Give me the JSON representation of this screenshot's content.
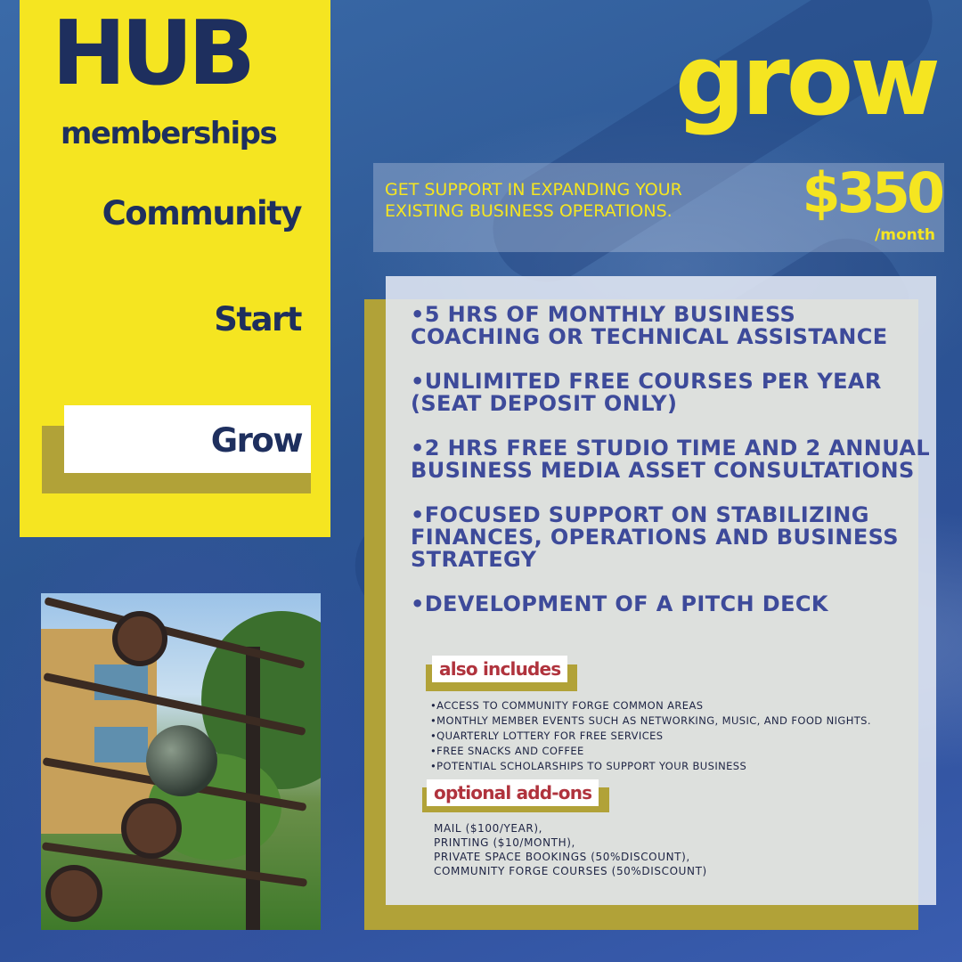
{
  "brand": {
    "title": "HUB",
    "subtitle": "memberships"
  },
  "tiers": [
    {
      "label": "Community",
      "active": false
    },
    {
      "label": "Start",
      "active": false
    },
    {
      "label": "Grow",
      "active": true
    }
  ],
  "plan": {
    "name": "grow",
    "tagline": "GET SUPPORT IN EXPANDING YOUR EXISTING BUSINESS OPERATIONS.",
    "price": "$350",
    "period": "/month"
  },
  "features": [
    "•5 HRS OF MONTHLY BUSINESS COACHING OR TECHNICAL ASSISTANCE",
    "•UNLIMITED FREE COURSES PER YEAR (SEAT DEPOSIT ONLY)",
    "•2 HRS FREE STUDIO TIME AND 2 ANNUAL BUSINESS MEDIA ASSET CONSULTATIONS",
    "•FOCUSED SUPPORT ON STABILIZING FINANCES, OPERATIONS AND BUSINESS STRATEGY",
    "•DEVELOPMENT OF A PITCH DECK"
  ],
  "also_includes": {
    "label": "also includes",
    "items": [
      "•ACCESS TO COMMUNITY FORGE COMMON AREAS",
      "•MONTHLY MEMBER EVENTS SUCH AS NETWORKING, MUSIC, AND FOOD NIGHTS.",
      "•QUARTERLY LOTTERY FOR FREE SERVICES",
      "•FREE SNACKS AND COFFEE",
      "•POTENTIAL SCHOLARSHIPS TO SUPPORT YOUR BUSINESS"
    ]
  },
  "optional_addons": {
    "label": "optional add-ons",
    "items": [
      "MAIL ($100/YEAR),",
      "PRINTING ($10/MONTH),",
      "PRIVATE SPACE BOOKINGS (50%DISCOUNT),",
      "COMMUNITY FORGE COURSES (50%DISCOUNT)"
    ]
  },
  "colors": {
    "yellow": "#f5e521",
    "navy": "#1e2f5e",
    "olive": "#b1a238",
    "bullet": "#3d4a9a",
    "accent_red": "#b0333d"
  }
}
